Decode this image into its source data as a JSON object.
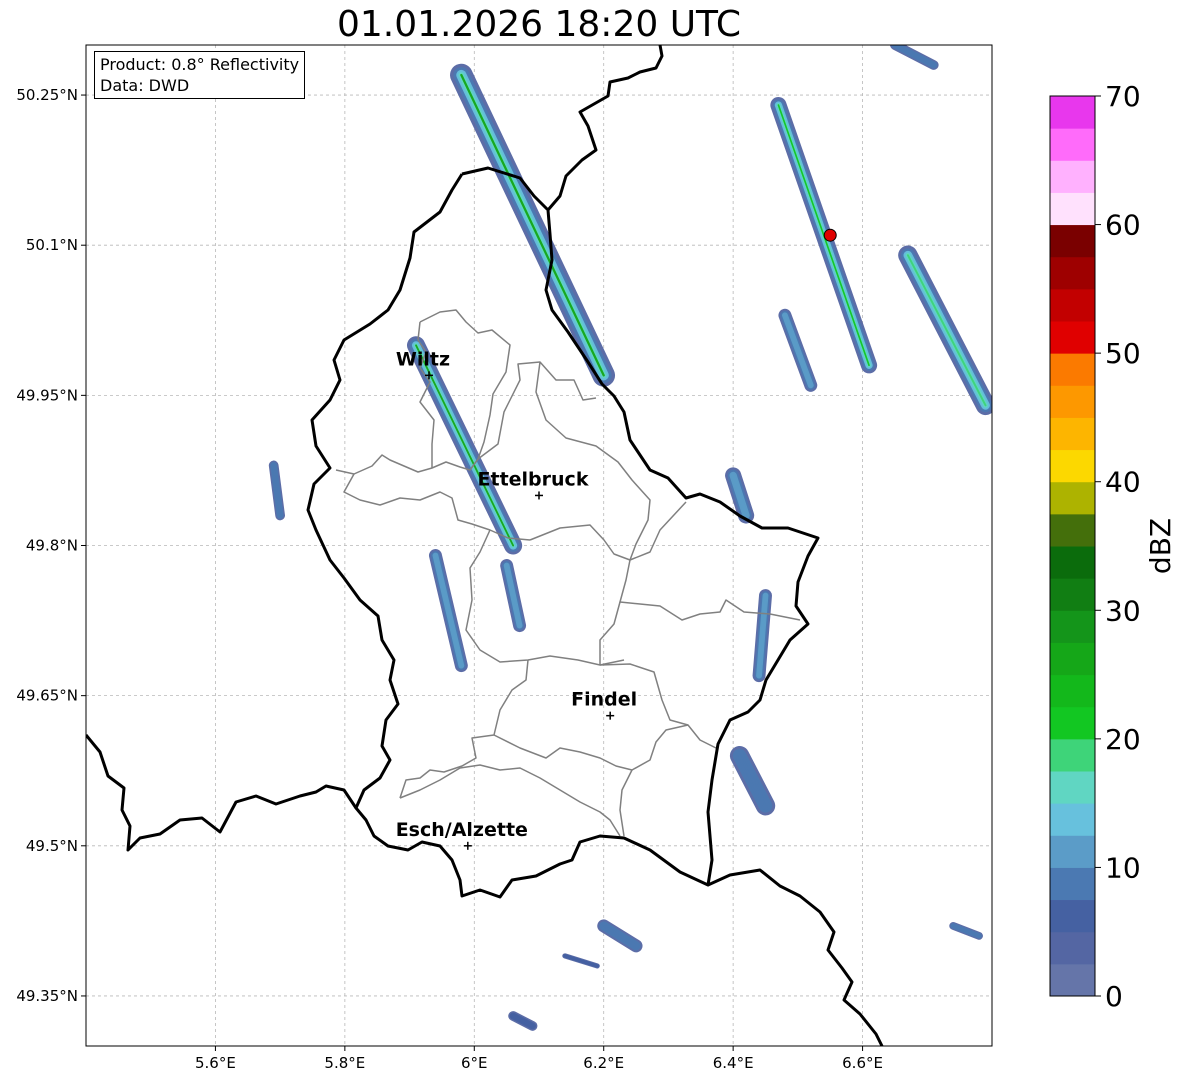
{
  "title": "01.01.2026 18:20 UTC",
  "info": {
    "product": "Product: 0.8° Reflectivity",
    "data": "Data: DWD"
  },
  "map": {
    "lon_range": [
      5.4,
      6.8
    ],
    "lat_range": [
      49.3,
      50.3
    ],
    "lon_ticks": [
      {
        "v": 5.6,
        "label": "5.6°E"
      },
      {
        "v": 5.8,
        "label": "5.8°E"
      },
      {
        "v": 6.0,
        "label": "6°E"
      },
      {
        "v": 6.2,
        "label": "6.2°E"
      },
      {
        "v": 6.4,
        "label": "6.4°E"
      },
      {
        "v": 6.6,
        "label": "6.6°E"
      }
    ],
    "lat_ticks": [
      {
        "v": 49.35,
        "label": "49.35°N"
      },
      {
        "v": 49.5,
        "label": "49.5°N"
      },
      {
        "v": 49.65,
        "label": "49.65°N"
      },
      {
        "v": 49.8,
        "label": "49.8°N"
      },
      {
        "v": 49.95,
        "label": "49.95°N"
      },
      {
        "v": 50.1,
        "label": "50.1°N"
      },
      {
        "v": 50.25,
        "label": "50.25°N"
      }
    ],
    "grid": true,
    "cities": [
      {
        "name": "Wiltz",
        "lon": 5.93,
        "lat": 49.97
      },
      {
        "name": "Ettelbruck",
        "lon": 6.1,
        "lat": 49.85
      },
      {
        "name": "Findel",
        "lon": 6.21,
        "lat": 49.63
      },
      {
        "name": "Esch/Alzette",
        "lon": 5.99,
        "lat": 49.5
      }
    ],
    "radar_site": {
      "lon": 6.55,
      "lat": 50.11
    },
    "precip_bands": [
      {
        "lon1": 5.98,
        "lat1": 50.27,
        "lon2": 6.2,
        "lat2": 49.97,
        "width": 0.035,
        "max_dbz": 26
      },
      {
        "lon1": 5.91,
        "lat1": 50.0,
        "lon2": 6.06,
        "lat2": 49.8,
        "width": 0.028,
        "max_dbz": 25
      },
      {
        "lon1": 6.47,
        "lat1": 50.24,
        "lon2": 6.61,
        "lat2": 49.98,
        "width": 0.025,
        "max_dbz": 22
      },
      {
        "lon1": 6.67,
        "lat1": 50.09,
        "lon2": 6.79,
        "lat2": 49.94,
        "width": 0.03,
        "max_dbz": 18
      },
      {
        "lon1": 6.48,
        "lat1": 50.03,
        "lon2": 6.52,
        "lat2": 49.96,
        "width": 0.02,
        "max_dbz": 10
      },
      {
        "lon1": 5.94,
        "lat1": 49.79,
        "lon2": 5.98,
        "lat2": 49.68,
        "width": 0.02,
        "max_dbz": 10
      },
      {
        "lon1": 6.05,
        "lat1": 49.78,
        "lon2": 6.07,
        "lat2": 49.72,
        "width": 0.02,
        "max_dbz": 10
      },
      {
        "lon1": 6.45,
        "lat1": 49.75,
        "lon2": 6.44,
        "lat2": 49.67,
        "width": 0.02,
        "max_dbz": 10
      },
      {
        "lon1": 6.4,
        "lat1": 49.87,
        "lon2": 6.42,
        "lat2": 49.83,
        "width": 0.025,
        "max_dbz": 12
      },
      {
        "lon1": 5.69,
        "lat1": 49.88,
        "lon2": 5.7,
        "lat2": 49.83,
        "width": 0.015,
        "max_dbz": 8
      },
      {
        "lon1": 6.41,
        "lat1": 49.59,
        "lon2": 6.45,
        "lat2": 49.54,
        "width": 0.03,
        "max_dbz": 8
      },
      {
        "lon1": 6.2,
        "lat1": 49.42,
        "lon2": 6.25,
        "lat2": 49.4,
        "width": 0.02,
        "max_dbz": 8
      },
      {
        "lon1": 6.74,
        "lat1": 49.42,
        "lon2": 6.78,
        "lat2": 49.41,
        "width": 0.012,
        "max_dbz": 8
      },
      {
        "lon1": 6.06,
        "lat1": 49.33,
        "lon2": 6.09,
        "lat2": 49.32,
        "width": 0.015,
        "max_dbz": 6
      },
      {
        "lon1": 6.14,
        "lat1": 49.39,
        "lon2": 6.19,
        "lat2": 49.38,
        "width": 0.008,
        "max_dbz": 6
      },
      {
        "lon1": 6.65,
        "lat1": 50.3,
        "lon2": 6.71,
        "lat2": 50.28,
        "width": 0.015,
        "max_dbz": 8
      }
    ]
  },
  "colorbar": {
    "label": "dBZ",
    "min": 0,
    "max": 70,
    "step": 2.5,
    "ticks": [
      0,
      10,
      20,
      30,
      40,
      50,
      60,
      70
    ],
    "colors": [
      "#6575a9",
      "#5466a3",
      "#4561a2",
      "#4b79b2",
      "#5b9cc8",
      "#67c1dd",
      "#60d6c2",
      "#3ed479",
      "#12c722",
      "#13b81b",
      "#15a718",
      "#14951a",
      "#117e13",
      "#0b6c0c",
      "#446f0b",
      "#adb300",
      "#fcd800",
      "#fdb500",
      "#fd9800",
      "#fb7a00",
      "#e00000",
      "#c20000",
      "#9e0000",
      "#7a0000",
      "#ffe1fd",
      "#ffb1fe",
      "#ff6bfa",
      "#e837ed"
    ]
  }
}
